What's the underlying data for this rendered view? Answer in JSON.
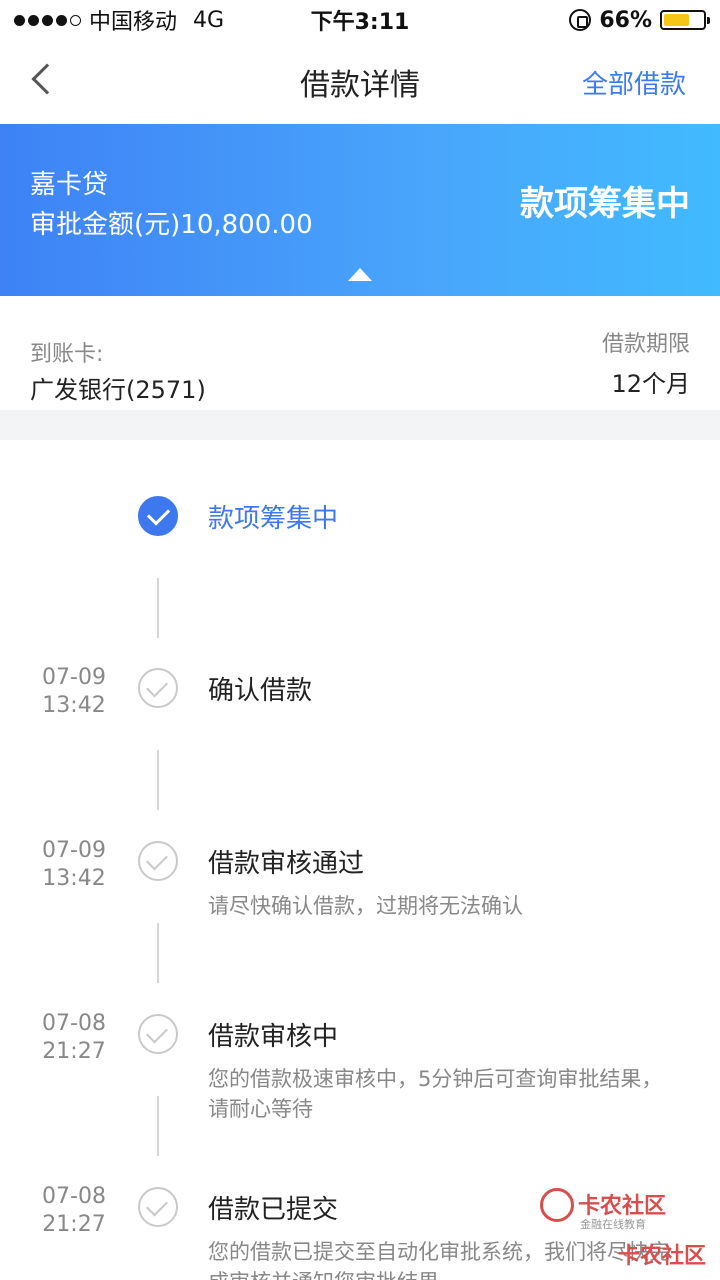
{
  "status_bar": {
    "carrier": "中国移动",
    "network": "4G",
    "time": "下午3:11",
    "battery_text": "66%",
    "battery_level": 0.66
  },
  "nav": {
    "title": "借款详情",
    "right_action": "全部借款"
  },
  "banner": {
    "product_name": "嘉卡贷",
    "amount_text": "审批金额(元)10,800.00",
    "status": "款项筹集中"
  },
  "info": {
    "card_label": "到账卡:",
    "card_value": "广发银行(2571)",
    "term_label": "借款期限",
    "term_value": "12个月"
  },
  "timeline": [
    {
      "date": "",
      "time": "",
      "title": "款项筹集中",
      "desc": "",
      "active": true
    },
    {
      "date": "07-09",
      "time": "13:42",
      "title": "确认借款",
      "desc": "",
      "active": false
    },
    {
      "date": "07-09",
      "time": "13:42",
      "title": "借款审核通过",
      "desc": "请尽快确认借款，过期将无法确认",
      "active": false
    },
    {
      "date": "07-08",
      "time": "21:27",
      "title": "借款审核中",
      "desc": "您的借款极速审核中，5分钟后可查询审批结果，请耐心等待",
      "active": false
    },
    {
      "date": "07-08",
      "time": "21:27",
      "title": "借款已提交",
      "desc": "您的借款已提交至自动化审批系统，我们将尽快完成审核并通知您审批结果",
      "active": false
    }
  ],
  "watermark": {
    "brand": "卡农社区",
    "sub": "金融在线教育",
    "brand2": "卡农社区"
  },
  "colors": {
    "accent": "#3e78ee",
    "banner_start": "#3e82f6",
    "banner_end": "#41baff",
    "battery": "#f5c518"
  }
}
